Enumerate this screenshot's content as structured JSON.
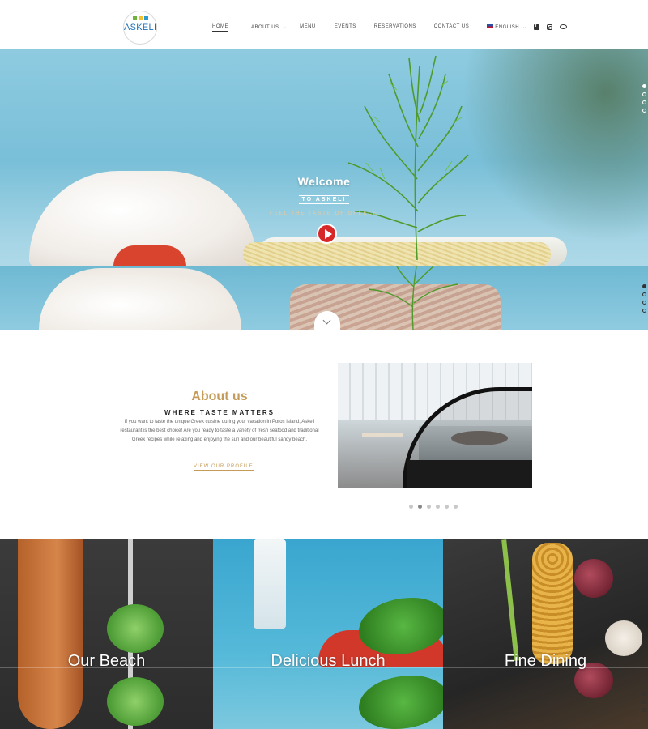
{
  "header": {
    "logo_text": "ASKELI",
    "nav": [
      {
        "label": "HOME",
        "active": true
      },
      {
        "label": "ABOUT US",
        "has_dropdown": true
      },
      {
        "label": "MENU"
      },
      {
        "label": "EVENTS"
      },
      {
        "label": "RESERVATIONS"
      },
      {
        "label": "CONTACT US"
      }
    ],
    "language": "ENGLISH",
    "social": [
      "facebook-icon",
      "instagram-icon",
      "tripadvisor-icon"
    ]
  },
  "hero": {
    "title": "Welcome",
    "subtitle": "TO ASKELI",
    "tagline": "FEEL THE TASTE OF GREECE",
    "slides_count": 4,
    "active_slide": 1
  },
  "about": {
    "title": "About us",
    "kicker": "WHERE TASTE MATTERS",
    "text": "If you want to taste the unique Greek cuisine during your vacation in Poros Island, Askeli restaurant is the best choice! Are you ready to taste a variety of fresh seafood and traditional Greek recipes while relaxing and enjoying the sun and our beautiful sandy beach.",
    "link_label": "VIEW OUR PROFILE",
    "gallery_count": 6,
    "gallery_active": 2
  },
  "tiles": [
    {
      "label": "Our Beach"
    },
    {
      "label": "Delicious Lunch"
    },
    {
      "label": "Fine Dining"
    }
  ],
  "colors": {
    "accent": "#c49b59",
    "play": "#d62828",
    "logo": "#1a6fb5"
  }
}
